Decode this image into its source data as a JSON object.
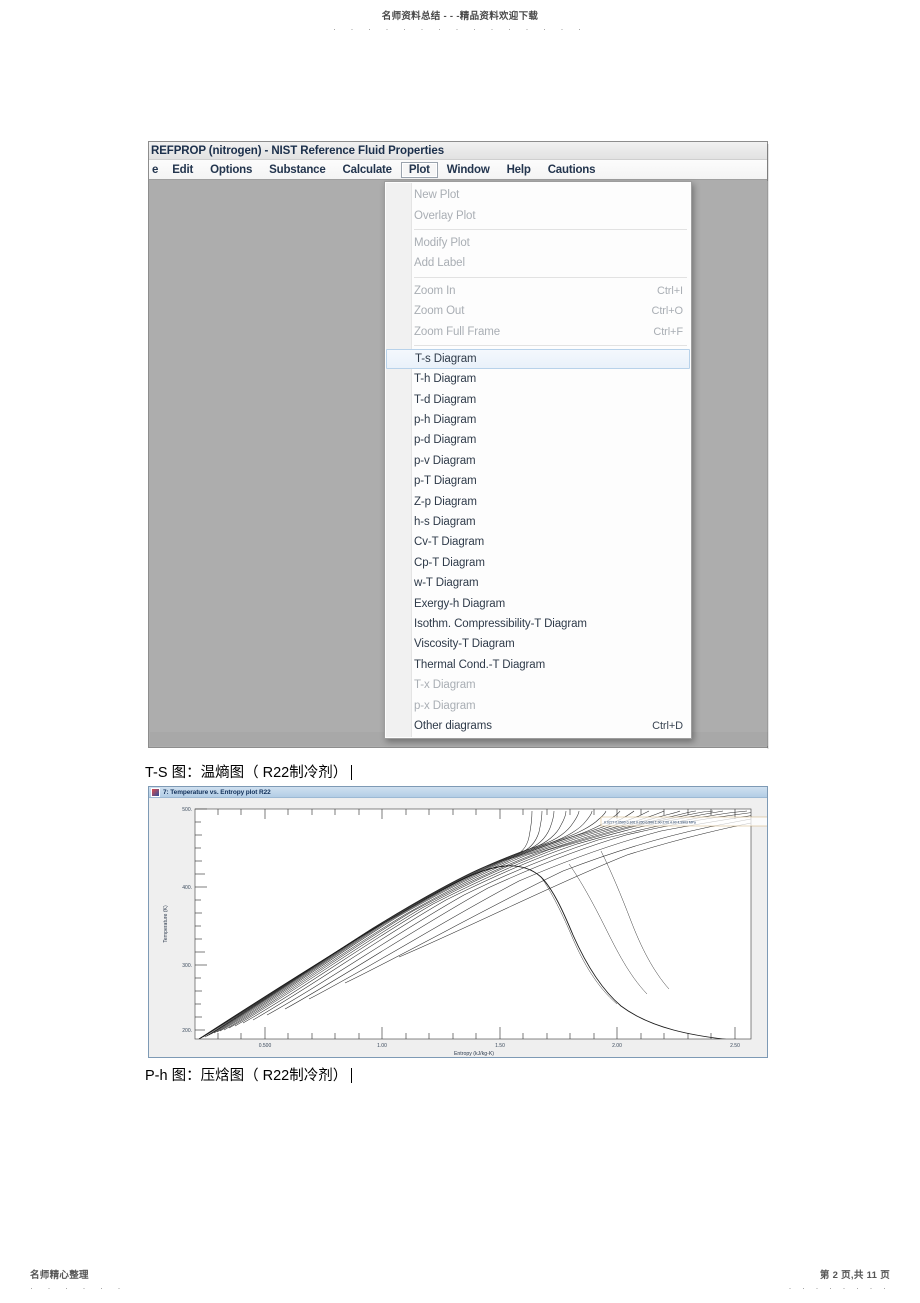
{
  "page": {
    "header_text": "名师资料总结 - - -精品资料欢迎下载",
    "header_dots": "· · · · · · · · · · · · · · ·",
    "footer_left": "名师精心整理",
    "footer_left_dots": "· · · · · ·",
    "footer_right": "第 2 页,共 11 页",
    "footer_right_dots": "· · · · · · · ·"
  },
  "app": {
    "title": "REFPROP (nitrogen) - NIST Reference Fluid Properties",
    "menubar": [
      {
        "label": "e",
        "open": false,
        "clipped": true
      },
      {
        "label": "Edit",
        "open": false
      },
      {
        "label": "Options",
        "open": false
      },
      {
        "label": "Substance",
        "open": false
      },
      {
        "label": "Calculate",
        "open": false
      },
      {
        "label": "Plot",
        "open": true
      },
      {
        "label": "Window",
        "open": false
      },
      {
        "label": "Help",
        "open": false
      },
      {
        "label": "Cautions",
        "open": false
      }
    ]
  },
  "plot_menu": {
    "groups": [
      {
        "items": [
          {
            "label": "New Plot",
            "accel": "",
            "disabled": true,
            "selected": false
          },
          {
            "label": "Overlay Plot",
            "accel": "",
            "disabled": true,
            "selected": false
          }
        ]
      },
      {
        "items": [
          {
            "label": "Modify Plot",
            "accel": "",
            "disabled": true,
            "selected": false
          },
          {
            "label": "Add Label",
            "accel": "",
            "disabled": true,
            "selected": false
          }
        ]
      },
      {
        "items": [
          {
            "label": "Zoom In",
            "accel": "Ctrl+I",
            "disabled": true,
            "selected": false
          },
          {
            "label": "Zoom Out",
            "accel": "Ctrl+O",
            "disabled": true,
            "selected": false
          },
          {
            "label": "Zoom Full Frame",
            "accel": "Ctrl+F",
            "disabled": true,
            "selected": false
          }
        ]
      },
      {
        "items": [
          {
            "label": "T-s Diagram",
            "accel": "",
            "disabled": false,
            "selected": true
          },
          {
            "label": "T-h Diagram",
            "accel": "",
            "disabled": false,
            "selected": false
          },
          {
            "label": "T-d Diagram",
            "accel": "",
            "disabled": false,
            "selected": false
          },
          {
            "label": "p-h Diagram",
            "accel": "",
            "disabled": false,
            "selected": false
          },
          {
            "label": "p-d Diagram",
            "accel": "",
            "disabled": false,
            "selected": false
          },
          {
            "label": "p-v Diagram",
            "accel": "",
            "disabled": false,
            "selected": false
          },
          {
            "label": "p-T Diagram",
            "accel": "",
            "disabled": false,
            "selected": false
          },
          {
            "label": "Z-p Diagram",
            "accel": "",
            "disabled": false,
            "selected": false
          },
          {
            "label": "h-s Diagram",
            "accel": "",
            "disabled": false,
            "selected": false
          },
          {
            "label": "Cv-T Diagram",
            "accel": "",
            "disabled": false,
            "selected": false
          },
          {
            "label": "Cp-T Diagram",
            "accel": "",
            "disabled": false,
            "selected": false
          },
          {
            "label": "w-T Diagram",
            "accel": "",
            "disabled": false,
            "selected": false
          },
          {
            "label": "Exergy-h Diagram",
            "accel": "",
            "disabled": false,
            "selected": false
          },
          {
            "label": "Isothm. Compressibility-T Diagram",
            "accel": "",
            "disabled": false,
            "selected": false
          },
          {
            "label": "Viscosity-T Diagram",
            "accel": "",
            "disabled": false,
            "selected": false
          },
          {
            "label": "Thermal Cond.-T Diagram",
            "accel": "",
            "disabled": false,
            "selected": false
          },
          {
            "label": "T-x Diagram",
            "accel": "",
            "disabled": true,
            "selected": false
          },
          {
            "label": "p-x Diagram",
            "accel": "",
            "disabled": true,
            "selected": false
          },
          {
            "label": "Other diagrams",
            "accel": "Ctrl+D",
            "disabled": false,
            "selected": false
          }
        ]
      }
    ]
  },
  "captions": {
    "ts": "T-S 图：温熵图（ R22制冷剂）",
    "ph": "P-h 图：压焓图（ R22制冷剂）"
  },
  "plot_window": {
    "title": "7: Temperature vs. Entropy plot R22",
    "legend": "0.0277 0.0500 0.100 0.200 0.500 1.00 2.00 4.00 4.9903 MPa"
  },
  "chart_data": {
    "type": "line",
    "title": "7: Temperature vs. Entropy plot R22",
    "xlabel": "Entropy (kJ/kg-K)",
    "ylabel": "Temperature (K)",
    "xlim": [
      0.28,
      2.62
    ],
    "ylim": [
      150,
      500
    ],
    "xticks": [
      0.5,
      1.0,
      1.5,
      2.0,
      2.5
    ],
    "xticklabels": [
      "0.500",
      "1.00",
      "1.50",
      "2.00",
      "2.50"
    ],
    "yticks": [
      200,
      300,
      400,
      500
    ],
    "yticklabels": [
      "200.",
      "300.",
      "400.",
      "500."
    ],
    "xminor_step": 0.1,
    "yminor_step": 20,
    "grid": false,
    "legend_position": "top-right",
    "series": [
      {
        "name": "saturation dome",
        "comment": "Two-phase boundary: saturated liquid (left) and saturated vapor (right), critical point near s=1.44, T=369.3 K",
        "points": [
          [
            0.3,
            152
          ],
          [
            0.4,
            172
          ],
          [
            0.5,
            192
          ],
          [
            0.6,
            213
          ],
          [
            0.7,
            235
          ],
          [
            0.8,
            257
          ],
          [
            0.9,
            279
          ],
          [
            1.0,
            300
          ],
          [
            1.1,
            320
          ],
          [
            1.2,
            338
          ],
          [
            1.3,
            353
          ],
          [
            1.38,
            363
          ],
          [
            1.44,
            369.3
          ],
          [
            1.52,
            368
          ],
          [
            1.58,
            364
          ],
          [
            1.64,
            354
          ],
          [
            1.7,
            337
          ],
          [
            1.76,
            315
          ],
          [
            1.82,
            295
          ],
          [
            1.9,
            272
          ],
          [
            2.0,
            248
          ],
          [
            2.1,
            226
          ],
          [
            2.2,
            208
          ],
          [
            2.3,
            192
          ],
          [
            2.4,
            178
          ],
          [
            2.5,
            166
          ],
          [
            2.58,
            157
          ]
        ]
      },
      {
        "name": "isobars",
        "comment": "Family of ~20 constant-pressure lines fanning from the dome up to 500 K, clustered at left and spreading right",
        "count": 20,
        "pressures_MPa": [
          0.0277,
          0.05,
          0.08,
          0.1,
          0.15,
          0.2,
          0.3,
          0.4,
          0.5,
          0.7,
          1.0,
          1.3,
          1.6,
          2.0,
          2.5,
          3.0,
          3.5,
          4.0,
          4.5,
          4.9903
        ]
      }
    ]
  }
}
